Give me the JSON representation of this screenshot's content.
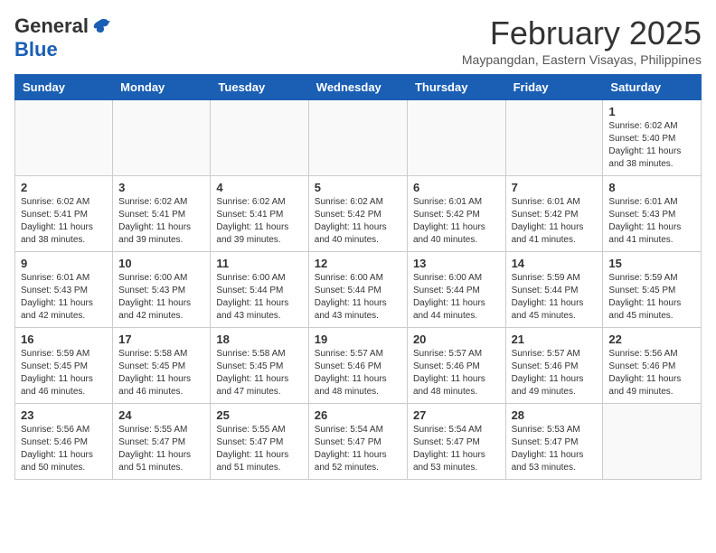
{
  "header": {
    "logo_general": "General",
    "logo_blue": "Blue",
    "month_title": "February 2025",
    "location": "Maypangdan, Eastern Visayas, Philippines"
  },
  "weekdays": [
    "Sunday",
    "Monday",
    "Tuesday",
    "Wednesday",
    "Thursday",
    "Friday",
    "Saturday"
  ],
  "weeks": [
    [
      {
        "day": "",
        "info": ""
      },
      {
        "day": "",
        "info": ""
      },
      {
        "day": "",
        "info": ""
      },
      {
        "day": "",
        "info": ""
      },
      {
        "day": "",
        "info": ""
      },
      {
        "day": "",
        "info": ""
      },
      {
        "day": "1",
        "info": "Sunrise: 6:02 AM\nSunset: 5:40 PM\nDaylight: 11 hours and 38 minutes."
      }
    ],
    [
      {
        "day": "2",
        "info": "Sunrise: 6:02 AM\nSunset: 5:41 PM\nDaylight: 11 hours and 38 minutes."
      },
      {
        "day": "3",
        "info": "Sunrise: 6:02 AM\nSunset: 5:41 PM\nDaylight: 11 hours and 39 minutes."
      },
      {
        "day": "4",
        "info": "Sunrise: 6:02 AM\nSunset: 5:41 PM\nDaylight: 11 hours and 39 minutes."
      },
      {
        "day": "5",
        "info": "Sunrise: 6:02 AM\nSunset: 5:42 PM\nDaylight: 11 hours and 40 minutes."
      },
      {
        "day": "6",
        "info": "Sunrise: 6:01 AM\nSunset: 5:42 PM\nDaylight: 11 hours and 40 minutes."
      },
      {
        "day": "7",
        "info": "Sunrise: 6:01 AM\nSunset: 5:42 PM\nDaylight: 11 hours and 41 minutes."
      },
      {
        "day": "8",
        "info": "Sunrise: 6:01 AM\nSunset: 5:43 PM\nDaylight: 11 hours and 41 minutes."
      }
    ],
    [
      {
        "day": "9",
        "info": "Sunrise: 6:01 AM\nSunset: 5:43 PM\nDaylight: 11 hours and 42 minutes."
      },
      {
        "day": "10",
        "info": "Sunrise: 6:00 AM\nSunset: 5:43 PM\nDaylight: 11 hours and 42 minutes."
      },
      {
        "day": "11",
        "info": "Sunrise: 6:00 AM\nSunset: 5:44 PM\nDaylight: 11 hours and 43 minutes."
      },
      {
        "day": "12",
        "info": "Sunrise: 6:00 AM\nSunset: 5:44 PM\nDaylight: 11 hours and 43 minutes."
      },
      {
        "day": "13",
        "info": "Sunrise: 6:00 AM\nSunset: 5:44 PM\nDaylight: 11 hours and 44 minutes."
      },
      {
        "day": "14",
        "info": "Sunrise: 5:59 AM\nSunset: 5:44 PM\nDaylight: 11 hours and 45 minutes."
      },
      {
        "day": "15",
        "info": "Sunrise: 5:59 AM\nSunset: 5:45 PM\nDaylight: 11 hours and 45 minutes."
      }
    ],
    [
      {
        "day": "16",
        "info": "Sunrise: 5:59 AM\nSunset: 5:45 PM\nDaylight: 11 hours and 46 minutes."
      },
      {
        "day": "17",
        "info": "Sunrise: 5:58 AM\nSunset: 5:45 PM\nDaylight: 11 hours and 46 minutes."
      },
      {
        "day": "18",
        "info": "Sunrise: 5:58 AM\nSunset: 5:45 PM\nDaylight: 11 hours and 47 minutes."
      },
      {
        "day": "19",
        "info": "Sunrise: 5:57 AM\nSunset: 5:46 PM\nDaylight: 11 hours and 48 minutes."
      },
      {
        "day": "20",
        "info": "Sunrise: 5:57 AM\nSunset: 5:46 PM\nDaylight: 11 hours and 48 minutes."
      },
      {
        "day": "21",
        "info": "Sunrise: 5:57 AM\nSunset: 5:46 PM\nDaylight: 11 hours and 49 minutes."
      },
      {
        "day": "22",
        "info": "Sunrise: 5:56 AM\nSunset: 5:46 PM\nDaylight: 11 hours and 49 minutes."
      }
    ],
    [
      {
        "day": "23",
        "info": "Sunrise: 5:56 AM\nSunset: 5:46 PM\nDaylight: 11 hours and 50 minutes."
      },
      {
        "day": "24",
        "info": "Sunrise: 5:55 AM\nSunset: 5:47 PM\nDaylight: 11 hours and 51 minutes."
      },
      {
        "day": "25",
        "info": "Sunrise: 5:55 AM\nSunset: 5:47 PM\nDaylight: 11 hours and 51 minutes."
      },
      {
        "day": "26",
        "info": "Sunrise: 5:54 AM\nSunset: 5:47 PM\nDaylight: 11 hours and 52 minutes."
      },
      {
        "day": "27",
        "info": "Sunrise: 5:54 AM\nSunset: 5:47 PM\nDaylight: 11 hours and 53 minutes."
      },
      {
        "day": "28",
        "info": "Sunrise: 5:53 AM\nSunset: 5:47 PM\nDaylight: 11 hours and 53 minutes."
      },
      {
        "day": "",
        "info": ""
      }
    ]
  ]
}
